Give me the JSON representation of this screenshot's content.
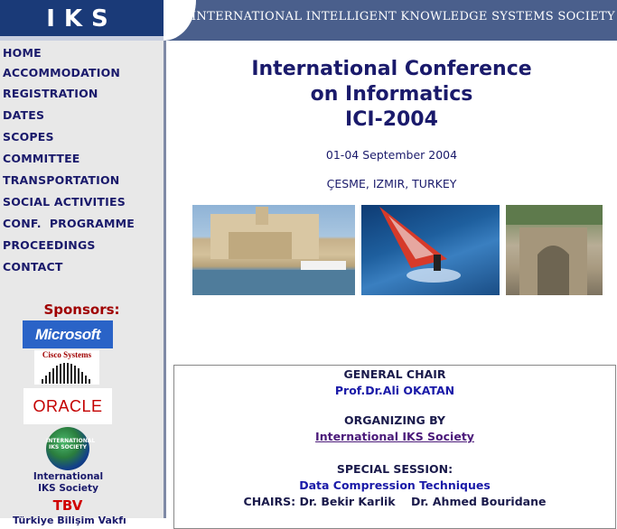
{
  "header": {
    "logo": "IKS",
    "banner": "INTERNATIONAL INTELLIGENT KNOWLEDGE SYSTEMS SOCIETY"
  },
  "nav": [
    {
      "label": "HOME"
    },
    {
      "label": "ACCOMMODATION"
    },
    {
      "label": "REGISTRATION"
    },
    {
      "label": "DATES"
    },
    {
      "label": "SCOPES"
    },
    {
      "label": "COMMITTEE"
    },
    {
      "label": "TRANSPORTATION"
    },
    {
      "label": "SOCIAL ACTIVITIES"
    },
    {
      "label": "CONF.  PROGRAMME"
    },
    {
      "label": "PROCEEDINGS"
    },
    {
      "label": "CONTACT"
    }
  ],
  "sponsors": {
    "title": "Sponsors:",
    "microsoft": "Microsoft",
    "cisco": "Cisco Systems",
    "oracle": "ORACLE",
    "iks_badge": "INTERNATIONAL IKS SOCIETY",
    "iks_label_1": "International",
    "iks_label_2": "IKS Society",
    "tbv": "TBV",
    "tbv_sub": "Türkiye Bilişim Vakfı"
  },
  "main": {
    "title_line1": "International Conference",
    "title_line2": "on Informatics",
    "title_line3": "ICI-2004",
    "dates": "01-04 September 2004",
    "location": "ÇESME, IZMIR, TURKEY"
  },
  "info": {
    "general_chair_label": "GENERAL CHAIR",
    "general_chair_name": "Prof.Dr.Ali OKATAN",
    "organizing_label": "ORGANIZING BY",
    "organizing_link": "International IKS Society",
    "special_session_label": "SPECIAL SESSION:",
    "special_session_name": "Data Compression Techniques",
    "chairs": "CHAIRS: Dr. Bekir Karlik    Dr. Ahmed Bouridane"
  }
}
